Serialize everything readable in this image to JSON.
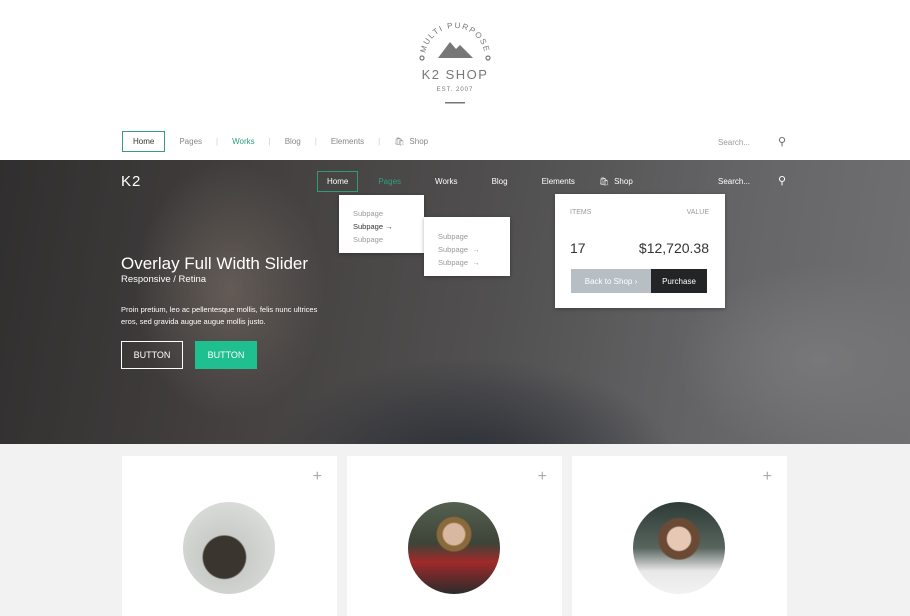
{
  "logo": {
    "arc_text": "MULTI PURPOSE",
    "name": "K2 SHOP",
    "est": "EST. 2007"
  },
  "nav_light": {
    "items": [
      "Home",
      "Pages",
      "Works",
      "Blog",
      "Elements",
      "Shop"
    ],
    "active": "Home",
    "hover": "Works",
    "search_placeholder": "Search..."
  },
  "hero": {
    "brand": "K2",
    "nav": {
      "items": [
        "Home",
        "Pages",
        "Works",
        "Blog",
        "Elements",
        "Shop"
      ],
      "active": "Home",
      "hover": "Pages",
      "search_placeholder": "Search..."
    },
    "dropdown1": [
      "Subpage",
      "Subpage",
      "Subpage"
    ],
    "dropdown2": [
      "Subpage",
      "Subpage",
      "Subpage"
    ],
    "cart": {
      "items_label": "ITEMS",
      "value_label": "VALUE",
      "items": "17",
      "value": "$12,720.38",
      "back_label": "Back to Shop",
      "purchase_label": "Purchase"
    },
    "title": "Overlay Full Width Slider",
    "subtitle": "Responsive / Retina",
    "text": "Proin pretium, leo ac pellentesque mollis, felis nunc ultrices eros, sed gravida augue augue mollis justo.",
    "button1": "BUTTON",
    "button2": "BUTTON"
  },
  "colors": {
    "accent": "#1fbf8f",
    "dark": "#222425",
    "gray_button": "#b7bec4"
  },
  "cards": [
    {
      "plus": "+"
    },
    {
      "plus": "+"
    },
    {
      "plus": "+"
    }
  ]
}
